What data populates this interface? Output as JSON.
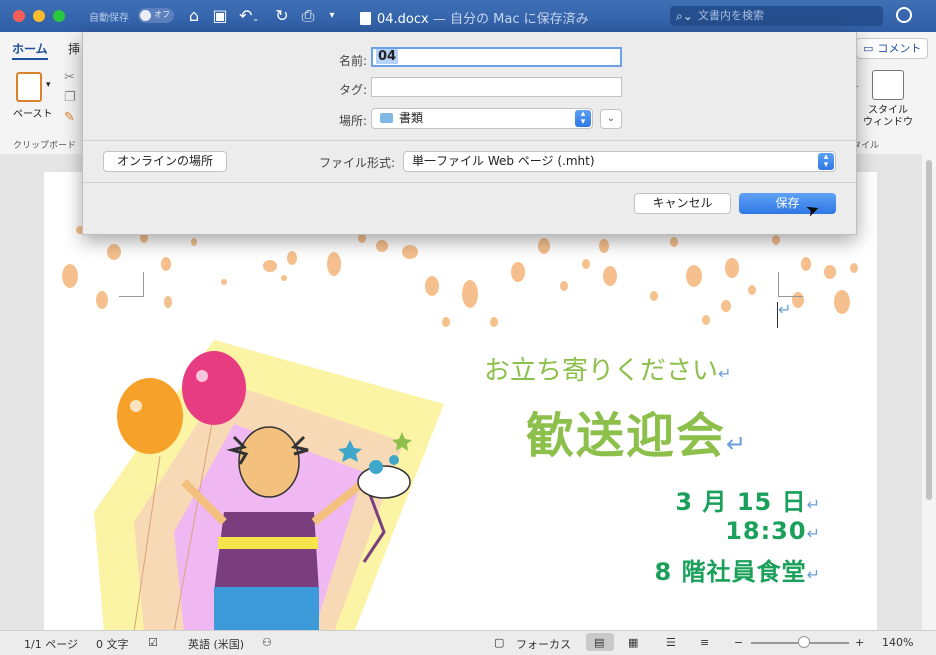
{
  "titlebar": {
    "autosave_label": "自動保存",
    "autosave_state": "オフ",
    "document_name": "04.docx",
    "document_status": "— 自分の Mac に保存済み",
    "search_placeholder": "文書内を検索",
    "icons": [
      "home-icon",
      "save-icon",
      "undo-icon",
      "redo-icon",
      "print-icon",
      "customize-icon",
      "account-icon"
    ]
  },
  "ribbon": {
    "tabs": [
      "ホーム",
      "挿"
    ],
    "paste_label": "ペースト",
    "clipboard_group": "クリップボード",
    "comment_label": "コメント",
    "styles_pane_label": "スタイル\nウィンドウ",
    "styles_group": "タイル"
  },
  "save_sheet": {
    "name_label": "名前:",
    "name_value": "04",
    "tags_label": "タグ:",
    "tags_value": "",
    "location_label": "場所:",
    "location_value": "書類",
    "online_button": "オンラインの場所",
    "format_label": "ファイル形式:",
    "format_value": "単一ファイル Web ページ (.mht)",
    "cancel_button": "キャンセル",
    "save_button": "保存"
  },
  "document": {
    "greeting": "お立ち寄りください",
    "event_title": "歓送迎会",
    "date": "3 月 15 日",
    "time": "18:30",
    "place": "8 階社員食堂",
    "return_mark": "↵"
  },
  "statusbar": {
    "page": "1/1 ページ",
    "words": "0 文字",
    "language": "英語 (米国)",
    "focus": "フォーカス",
    "zoom": "140%",
    "zoom_level": 0.5
  },
  "colors": {
    "titlebar": "#2f5ea6",
    "accent": "#2e77e5",
    "doc_green_light": "#8cc04b",
    "doc_green_dark": "#1aa05a",
    "confetti": "#f6c08e"
  }
}
